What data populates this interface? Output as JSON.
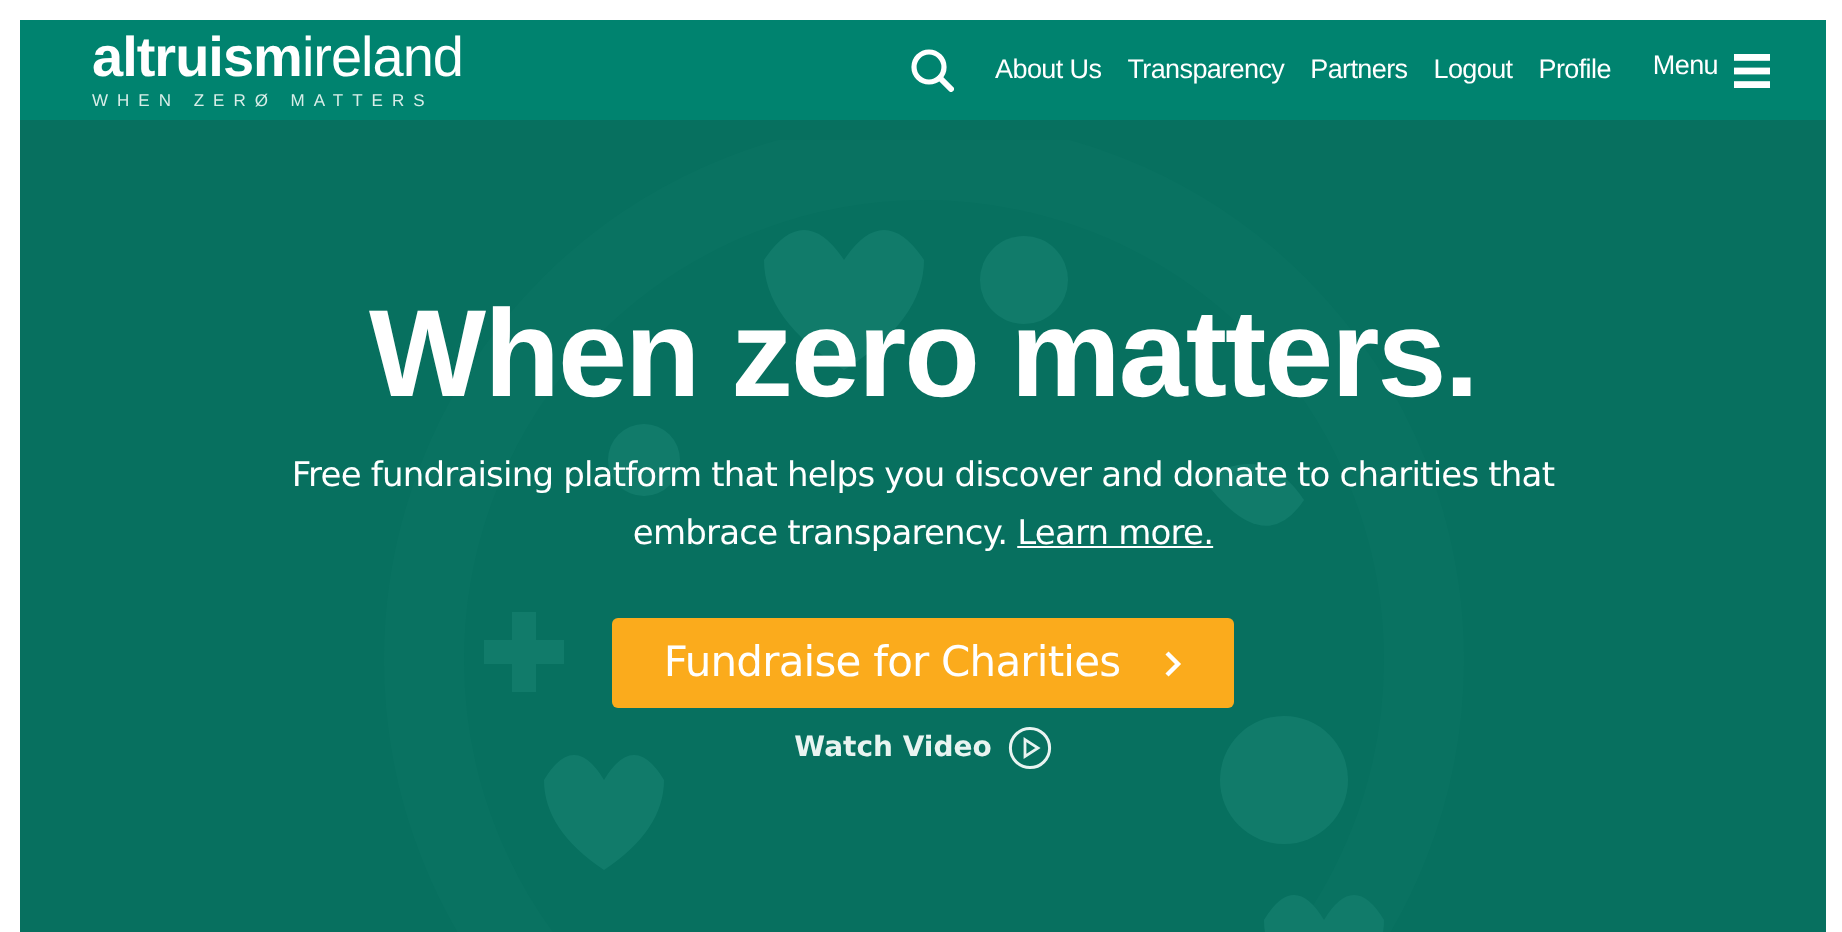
{
  "header": {
    "logo": "**altruism**ireland",
    "tagline": "WHEN ZERØ MATTERS",
    "nav": [
      "About Us",
      "Transparency",
      "Partners",
      "Logout",
      "Profile"
    ],
    "menu_label": "Menu"
  },
  "hero": {
    "heading": "When zero matters.",
    "description": "Free fundraising platform that helps you discover and donate to charities that embrace transparency.",
    "link": "Learn more.",
    "cta": "Fundraise for Charities",
    "video_link": "Watch Video"
  }
}
